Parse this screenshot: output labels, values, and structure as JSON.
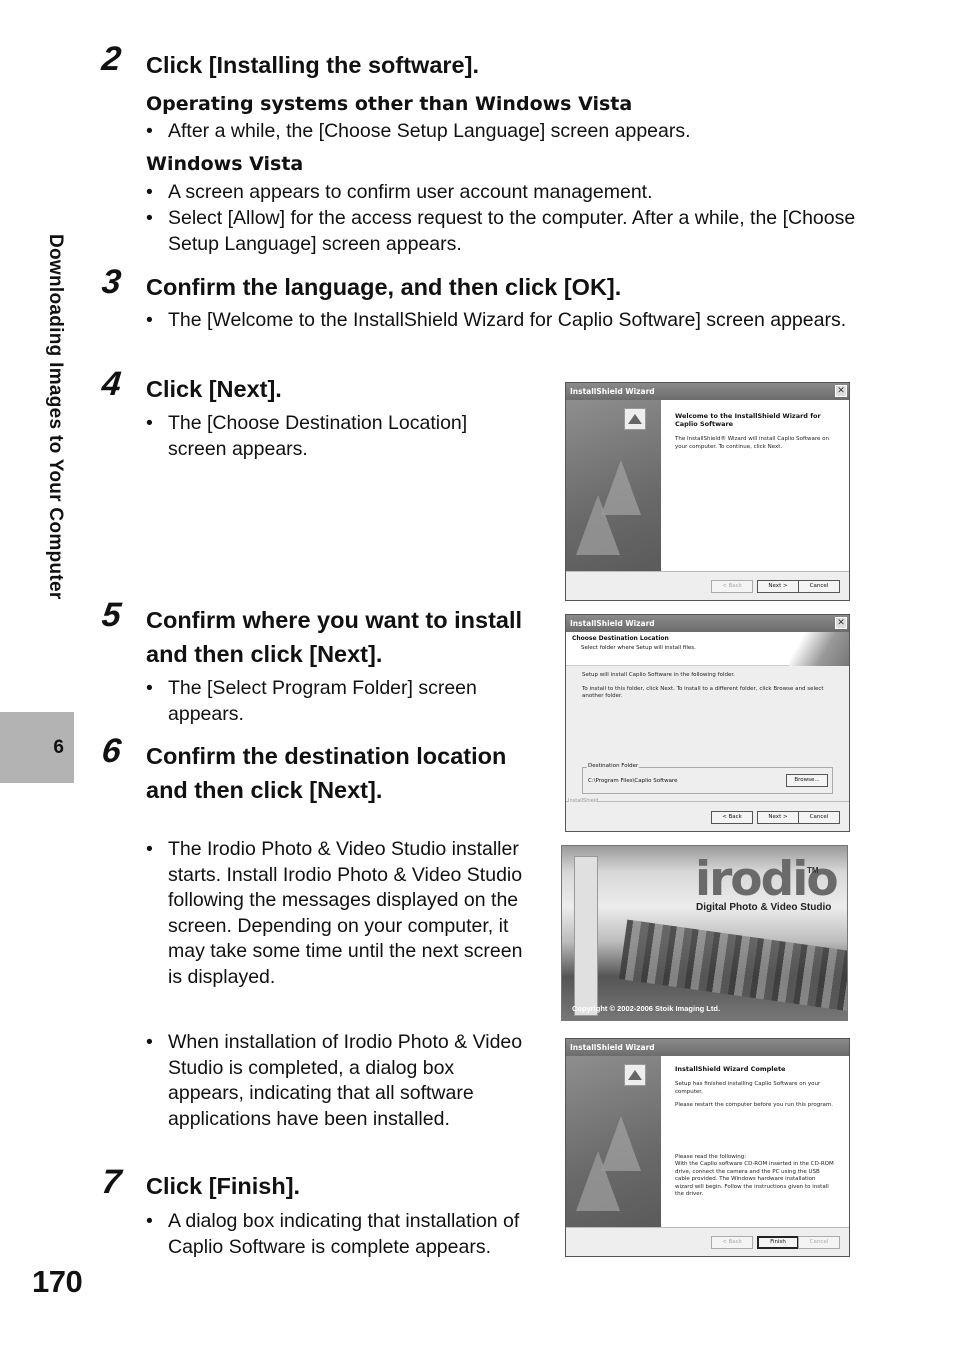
{
  "sidebar": {
    "section_title": "Downloading Images to Your Computer",
    "chapter_number": "6"
  },
  "page_number": "170",
  "bullet_char": "•",
  "steps": [
    {
      "number": "2",
      "title": "Click [Installing the software].",
      "groups": [
        {
          "subhead": "Operating systems other than Windows Vista",
          "bullets": [
            "After a while, the [Choose Setup Language] screen appears."
          ]
        },
        {
          "subhead": "Windows Vista",
          "bullets": [
            "A screen appears to confirm user account management.",
            "Select [Allow] for the access request to the computer. After a while, the [Choose Setup Language] screen appears."
          ]
        }
      ]
    },
    {
      "number": "3",
      "title": "Confirm the language, and then click [OK].",
      "bullets": [
        "The [Welcome to the InstallShield Wizard for Caplio Software] screen appears."
      ]
    },
    {
      "number": "4",
      "title": "Click [Next].",
      "bullets": [
        "The [Choose Destination Location] screen appears."
      ]
    },
    {
      "number": "5",
      "title": "Confirm where you want to install and then click [Next].",
      "bullets": [
        "The [Select Program Folder] screen appears."
      ]
    },
    {
      "number": "6",
      "title": "Confirm the destination location and then click [Next].",
      "bullets": [
        "The Irodio Photo & Video Studio installer starts. Install Irodio Photo & Video Studio following the messages displayed on the screen. Depending on your computer, it may take some time until the next screen is displayed.",
        "When installation of Irodio Photo & Video Studio is completed, a dialog box appears, indicating that all software applications have been installed."
      ]
    },
    {
      "number": "7",
      "title": "Click [Finish].",
      "bullets": [
        "A dialog box indicating that installation of Caplio Software is complete appears."
      ]
    }
  ],
  "dialogs": {
    "welcome": {
      "title": "InstallShield Wizard",
      "close": "✕",
      "heading": "Welcome to the InstallShield Wizard for Caplio Software",
      "text": "The InstallShield® Wizard will install Caplio Software on your computer.  To continue, click Next.",
      "back": "< Back",
      "next": "Next >",
      "cancel": "Cancel"
    },
    "destination": {
      "title": "InstallShield Wizard",
      "close": "✕",
      "heading": "Choose Destination Location",
      "subheading": "Select folder where Setup will install files.",
      "text1": "Setup will install Caplio Software in the following folder.",
      "text2": "To install to this folder, click Next. To install to a different folder, click Browse and select another folder.",
      "folder_legend": "Destination Folder",
      "folder_path": "C:\\Program Files\\Caplio Software",
      "browse": "Browse...",
      "brand": "InstallShield",
      "back": "< Back",
      "next": "Next >",
      "cancel": "Cancel"
    },
    "splash": {
      "brand": "irodio",
      "tm": "TM",
      "subtitle": "Digital Photo & Video Studio",
      "copyright": "Copyright © 2002-2006 Stoik Imaging Ltd."
    },
    "complete": {
      "title": "InstallShield Wizard",
      "heading": "InstallShield Wizard Complete",
      "text1": "Setup has finished installing Caplio Software on your computer.",
      "text2": "Please restart the computer before you run this program.",
      "text3": "Please read the following:",
      "text4": "With the Caplio software CD-ROM inserted in the CD-ROM drive, connect the camera and the PC using the USB cable provided. The Windows hardware installation wizard will begin. Follow the instructions given to install the driver.",
      "back": "< Back",
      "finish": "Finish",
      "cancel": "Cancel"
    }
  }
}
